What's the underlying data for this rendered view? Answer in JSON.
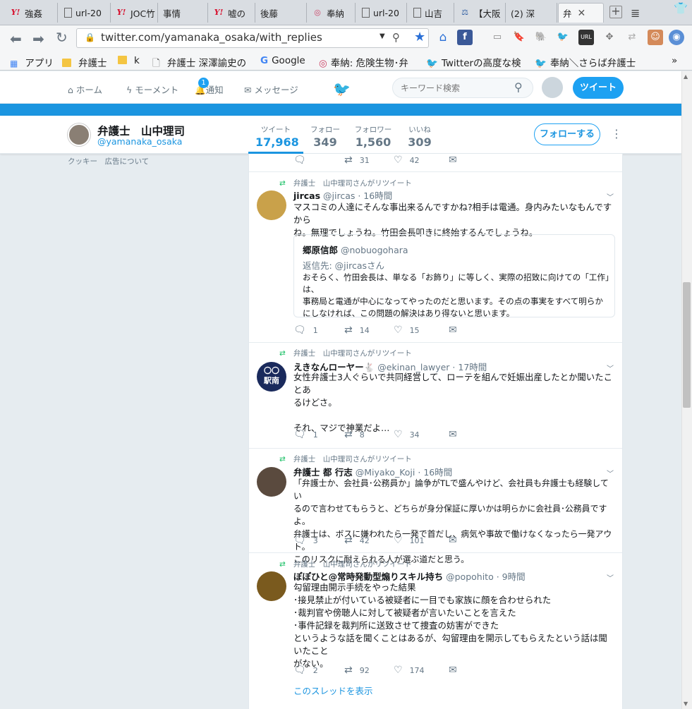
{
  "browser": {
    "tabs": [
      {
        "icon": "yahoo-icon",
        "label": "強姦"
      },
      {
        "icon": "document-icon",
        "label": "url-20"
      },
      {
        "icon": "yahoo-icon",
        "label": "JOC竹"
      },
      {
        "icon": "twitter-bird-icon",
        "label": "事情"
      },
      {
        "icon": "yahoo-icon",
        "label": "嘘の"
      },
      {
        "icon": "twitter-bird-icon",
        "label": "後藤"
      },
      {
        "icon": "houno-icon",
        "label": "奉納"
      },
      {
        "icon": "document-icon",
        "label": "url-20"
      },
      {
        "icon": "document-icon",
        "label": "山吉"
      },
      {
        "icon": "court-icon",
        "label": "【大阪"
      },
      {
        "icon": "twitter-bird-icon",
        "label": "(2) 深"
      },
      {
        "icon": "twitter-bird-icon",
        "label": "弁"
      }
    ],
    "url": "twitter.com/yamanaka_osaka/with_replies",
    "bookmarks": [
      {
        "icon": "apps-icon",
        "label": "アプリ"
      },
      {
        "icon": "folder-icon",
        "label": "弁護士"
      },
      {
        "icon": "folder-icon",
        "label": "k"
      },
      {
        "icon": "document-icon",
        "label": "弁護士 深澤諭史の"
      },
      {
        "icon": "google-icon",
        "label": "Google"
      },
      {
        "icon": "houno-icon",
        "label": "奉納: 危険生物･弁"
      },
      {
        "icon": "twitter-bird-icon",
        "label": "Twitterの高度な検"
      },
      {
        "icon": "twitter-bird-icon",
        "label": "奉納＼さらば弁護士"
      }
    ],
    "more_bookmarks": "»"
  },
  "nav": {
    "home": "ホーム",
    "moments": "モーメント",
    "notifications": "通知",
    "notifications_count": "1",
    "messages": "メッセージ",
    "search_placeholder": "キーワード検索",
    "tweet_button": "ツイート"
  },
  "profile": {
    "name": "弁護士　山中理司",
    "handle": "@yamanaka_osaka",
    "stats": [
      {
        "label": "ツイート",
        "value": "17,968"
      },
      {
        "label": "フォロー",
        "value": "349"
      },
      {
        "label": "フォロワー",
        "value": "1,560"
      },
      {
        "label": "いいね",
        "value": "309"
      }
    ],
    "follow_button": "フォローする",
    "sidebar_footer": "クッキー　広告について"
  },
  "timeline": {
    "partial_top": {
      "replies": "",
      "retweets": "31",
      "likes": "42"
    },
    "tweets": [
      {
        "retweeted_by": "弁護士　山中理司さんがリツイート",
        "name": "jircas",
        "handle": "@jircas",
        "time": "· 16時間",
        "text": "マスコミの人達にそんな事出来るんですかね?相手は電通。身内みたいなもんですから\nね。無理でしょうね。竹田会長叩きに終始するんでしょうね。",
        "quote": {
          "name": "郷原信郎",
          "handle": "@nobuogohara",
          "reply_to": "返信先: @jircasさん",
          "text": "おそらく、竹田会長は、単なる「お飾り」に等しく、実際の招致に向けての「工作」は、\n事務局と電通が中心になってやったのだと思います。その点の事実をすべて明らか\nにしなければ、この問題の解決はあり得ないと思います。"
        },
        "replies": "1",
        "retweets": "14",
        "likes": "15"
      },
      {
        "retweeted_by": "弁護士　山中理司さんがリツイート",
        "name": "えきなんローヤー🐇",
        "handle": "@ekinan_lawyer",
        "time": "· 17時間",
        "avatar_text": "〇〇\n駅南",
        "text": "女性弁護士3人ぐらいで共同経営して、ローテを組んで妊娠出産したとか聞いたことあ\nるけどさ。\n\nそれ、マジで神業だよ…",
        "replies": "1",
        "retweets": "8",
        "likes": "34"
      },
      {
        "retweeted_by": "弁護士　山中理司さんがリツイート",
        "name": "弁護士 都 行志",
        "handle": "@Miyako_Koji",
        "time": "· 16時間",
        "text": "「弁護士か、会社員･公務員か」論争がTLで盛んやけど、会社員も弁護士も経験してい\nるので言わせてもらうと、どちらが身分保証に厚いかは明らかに会社員･公務員ですよ。\n弁護士は、ボスに嫌われたら一発で首だし、病気や事故で働けなくなったら一発アウト。\nこのリスクに耐えられる人が選ぶ道だと思う。",
        "replies": "3",
        "retweets": "42",
        "likes": "101"
      },
      {
        "retweeted_by": "弁護士　山中理司さんがリツイート",
        "name": "ぽぽひと@常時発動型煽りスキル持ち",
        "handle": "@popohito",
        "time": "· 9時間",
        "text": "勾留理由開示手続をやった結果\n･接見禁止が付いている被疑者に一目でも家族に顔を合わせられた\n･裁判官や傍聴人に対して被疑者が言いたいことを言えた\n･事件記録を裁判所に送致させて捜査の妨害ができた\nというような話を聞くことはあるが、勾留理由を開示してもらえたという話は聞いたこと\nがない。",
        "replies": "2",
        "retweets": "92",
        "likes": "174",
        "show_thread": "このスレッドを表示"
      }
    ]
  },
  "colors": {
    "accent": "#1da1f2",
    "link": "#1b95e0",
    "retweet": "#17bf63",
    "muted": "#657786",
    "background": "#e6ecf0"
  }
}
